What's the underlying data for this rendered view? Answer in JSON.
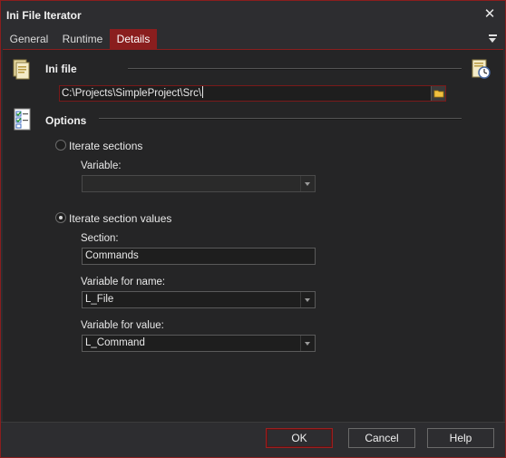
{
  "window": {
    "title": "Ini File Iterator",
    "close_glyph": "✕"
  },
  "tabs": [
    {
      "label": "General"
    },
    {
      "label": "Runtime"
    },
    {
      "label": "Details"
    }
  ],
  "ini_file": {
    "label": "Ini file",
    "path_value": "C:\\Projects\\SimpleProject\\Src\\"
  },
  "options": {
    "label": "Options",
    "iterate_sections": {
      "label": "Iterate sections",
      "checked": false,
      "variable_label": "Variable:",
      "variable_value": ""
    },
    "iterate_section_values": {
      "label": "Iterate section values",
      "checked": true,
      "section_label": "Section:",
      "section_value": "Commands",
      "var_name_label": "Variable for name:",
      "var_name_value": "L_File",
      "var_value_label": "Variable for value:",
      "var_value_value": "L_Command"
    }
  },
  "buttons": {
    "ok": "OK",
    "cancel": "Cancel",
    "help": "Help"
  },
  "colors": {
    "accent": "#8a1e1e",
    "background": "#2d2d30",
    "panel": "#252526"
  }
}
